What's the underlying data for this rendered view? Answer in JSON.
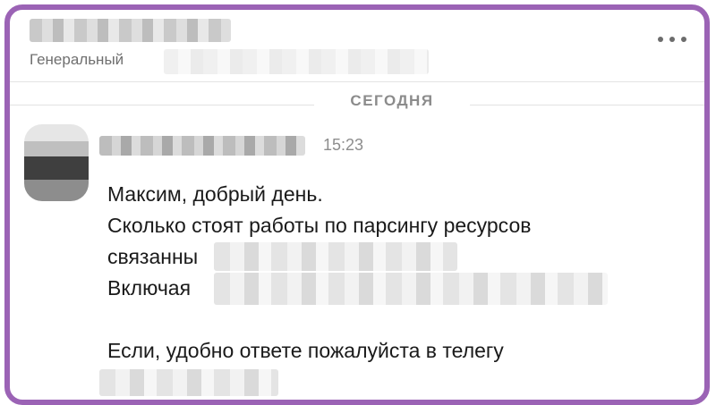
{
  "header": {
    "subtitle": "Генеральный",
    "menu_icon": "more-horizontal-icon"
  },
  "date_separator": "СЕГОДНЯ",
  "message": {
    "time": "15:23",
    "lines": [
      "Максим, добрый день.",
      "Сколько стоят работы по парсингу ресурсов",
      "связанны",
      "Включая",
      "Если, удобно ответе пожалуйста в телегу"
    ]
  },
  "colors": {
    "frame_border": "#9b63b5",
    "text": "#1a1a1a",
    "muted_text": "#8b8b8b"
  }
}
